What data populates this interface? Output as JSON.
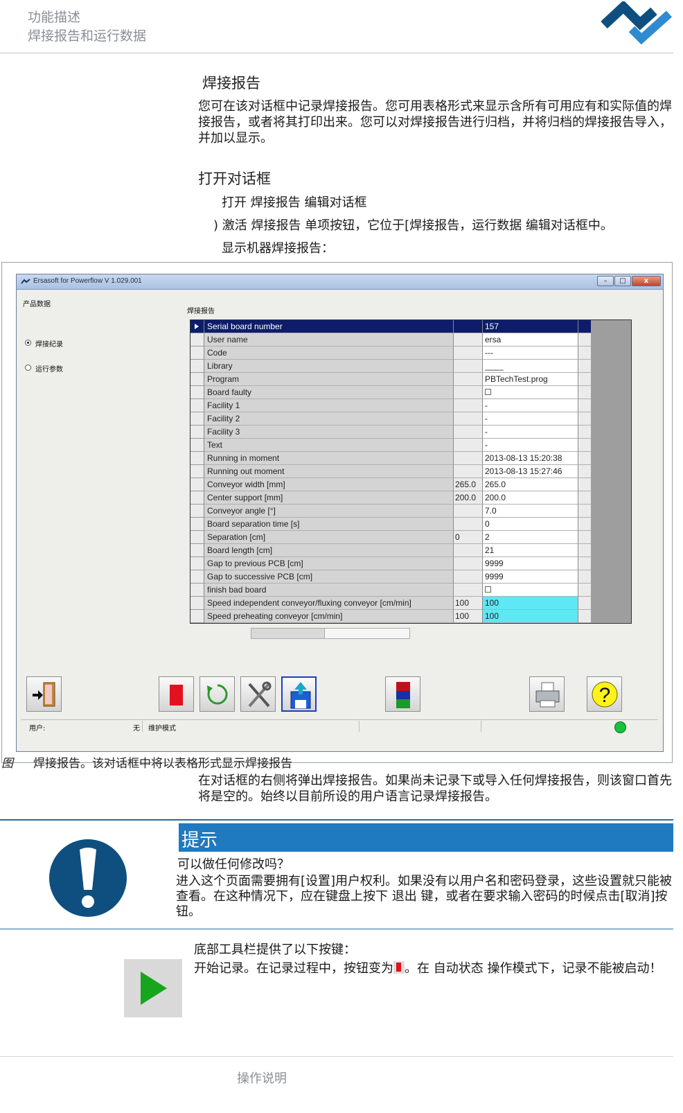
{
  "header": {
    "line1": "功能描述",
    "line2": "焊接报告和运行数据",
    "brand_color": "#0e4f80",
    "accent_color": "#2f8ad0"
  },
  "section": {
    "title": "焊接报告",
    "intro": "您可在该对话框中记录焊接报告。您可用表格形式来显示含所有可用应有和实际值的焊接报告，或者将其打印出来。您可以对焊接报告进行归档，并将归档的焊接报告导入，并加以显示。"
  },
  "open_dialog": {
    "title": "打开对话框",
    "step1": "打开 焊接报告  编辑对话框",
    "step2": ") 激活 焊接报告  单项按钮，它位于[焊接报告，运行数据  编辑对话框中。",
    "step3": "显示机器焊接报告："
  },
  "window": {
    "title": "Ersasoft for Powerflow V 1.029.001",
    "min_label": "–",
    "max_label": "□",
    "close_label": "x",
    "panel_label": "产品数据",
    "radio_report": "焊接纪录",
    "radio_runtime": "运行参数",
    "grid_label": "焊接报告",
    "rows": [
      {
        "label": "Serial board number",
        "ref": "",
        "actual": "157"
      },
      {
        "label": "User name",
        "ref": "",
        "actual": "ersa"
      },
      {
        "label": "Code",
        "ref": "",
        "actual": "---"
      },
      {
        "label": "Library",
        "ref": "",
        "actual": "____"
      },
      {
        "label": "Program",
        "ref": "",
        "actual": "PBTechTest.prog"
      },
      {
        "label": "Board faulty",
        "ref": "",
        "actual": ""
      },
      {
        "label": "Facility 1",
        "ref": "",
        "actual": "-"
      },
      {
        "label": "Facility 2",
        "ref": "",
        "actual": "-"
      },
      {
        "label": "Facility 3",
        "ref": "",
        "actual": "-"
      },
      {
        "label": "Text",
        "ref": "",
        "actual": "-"
      },
      {
        "label": "Running in moment",
        "ref": "",
        "actual": "2013-08-13 15:20:38"
      },
      {
        "label": "Running out moment",
        "ref": "",
        "actual": "2013-08-13 15:27:46"
      },
      {
        "label": "Conveyor width [mm]",
        "ref": "265.0",
        "actual": "265.0"
      },
      {
        "label": "Center support [mm]",
        "ref": "200.0",
        "actual": "200.0"
      },
      {
        "label": "Conveyor angle [°]",
        "ref": "",
        "actual": "7.0"
      },
      {
        "label": "Board separation time [s]",
        "ref": "",
        "actual": "0"
      },
      {
        "label": "Separation [cm]",
        "ref": "0",
        "actual": "2"
      },
      {
        "label": "Board length [cm]",
        "ref": "",
        "actual": "21"
      },
      {
        "label": "Gap to previous PCB [cm]",
        "ref": "",
        "actual": "9999"
      },
      {
        "label": "Gap to successive PCB [cm]",
        "ref": "",
        "actual": "9999"
      },
      {
        "label": "finish bad board",
        "ref": "",
        "actual": ""
      },
      {
        "label": "Speed independent conveyor/fluxing conveyor [cm/min]",
        "ref": "100",
        "actual": "100"
      },
      {
        "label": "Speed preheating conveyor [cm/min]",
        "ref": "100",
        "actual": "100"
      }
    ],
    "toolbar": [
      "exit-door-icon",
      "record-stop-icon",
      "refresh-icon",
      "tools-icon",
      "save-upload-icon",
      "color-bars-icon",
      "printer-icon",
      "help-icon"
    ],
    "help_glyph": "?",
    "status_user_label": "用户:",
    "status_user_value": "无",
    "status_mode": "维护模式",
    "status_ok_color": "#18c13a",
    "selected_row_color": "#0d1d6b",
    "highlight_color": "#5ee7f4"
  },
  "figure": {
    "label": "图",
    "caption": "焊接报告。该对话框中将以表格形式显示焊接报告"
  },
  "after_figure": "在对话框的右侧将弹出焊接报告。如果尚未记录下或导入任何焊接报告，则该窗口首先将是空的。始终以目前所设的用户语言记录焊接报告。",
  "note": {
    "title": "提示",
    "question": "可以做任何修改吗？",
    "body": "进入这个页面需要拥有[设置]用户权利。如果没有以用户名和密码登录，这些设置就只能被查看。在这种情况下，应在键盘上按下      退出 键，或者在要求输入密码的时候点击[取消]按钮。",
    "color": "#1f7ac0"
  },
  "toolbar_section": {
    "intro": "底部工具栏提供了以下按键：",
    "start_a": "开始记录。在记录过程中，按钮变为",
    "start_b": "。在 自动状态 操作模式下，记录不能被启动！"
  },
  "footer": "操作说明"
}
